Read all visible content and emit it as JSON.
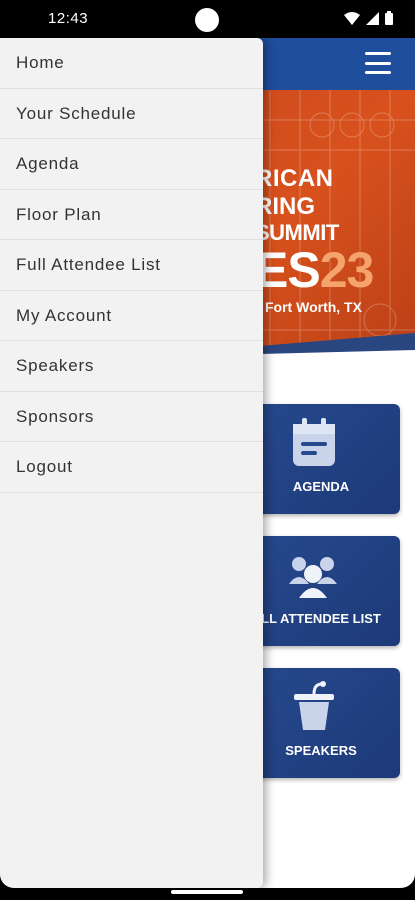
{
  "status_bar": {
    "time": "12:43"
  },
  "banner": {
    "line1": "RICAN",
    "line2": "RING",
    "line3": "SUMMIT",
    "big_prefix": "ES",
    "big_accent": "23",
    "location": "Fort Worth, TX"
  },
  "tiles": [
    {
      "label": "AGENDA",
      "icon": "calendar-icon"
    },
    {
      "label": "LL ATTENDEE LIST",
      "icon": "people-icon"
    },
    {
      "label": "SPEAKERS",
      "icon": "podium-icon"
    }
  ],
  "drawer": {
    "items": [
      {
        "label": "Home"
      },
      {
        "label": "Your Schedule"
      },
      {
        "label": "Agenda"
      },
      {
        "label": "Floor Plan"
      },
      {
        "label": "Full Attendee List"
      },
      {
        "label": "My Account"
      },
      {
        "label": "Speakers"
      },
      {
        "label": "Sponsors"
      },
      {
        "label": "Logout"
      }
    ]
  },
  "colors": {
    "header": "#1f4e9c",
    "banner": "#d8511d",
    "tile": "#274a8f",
    "drawer_bg": "#f2f2f2"
  }
}
